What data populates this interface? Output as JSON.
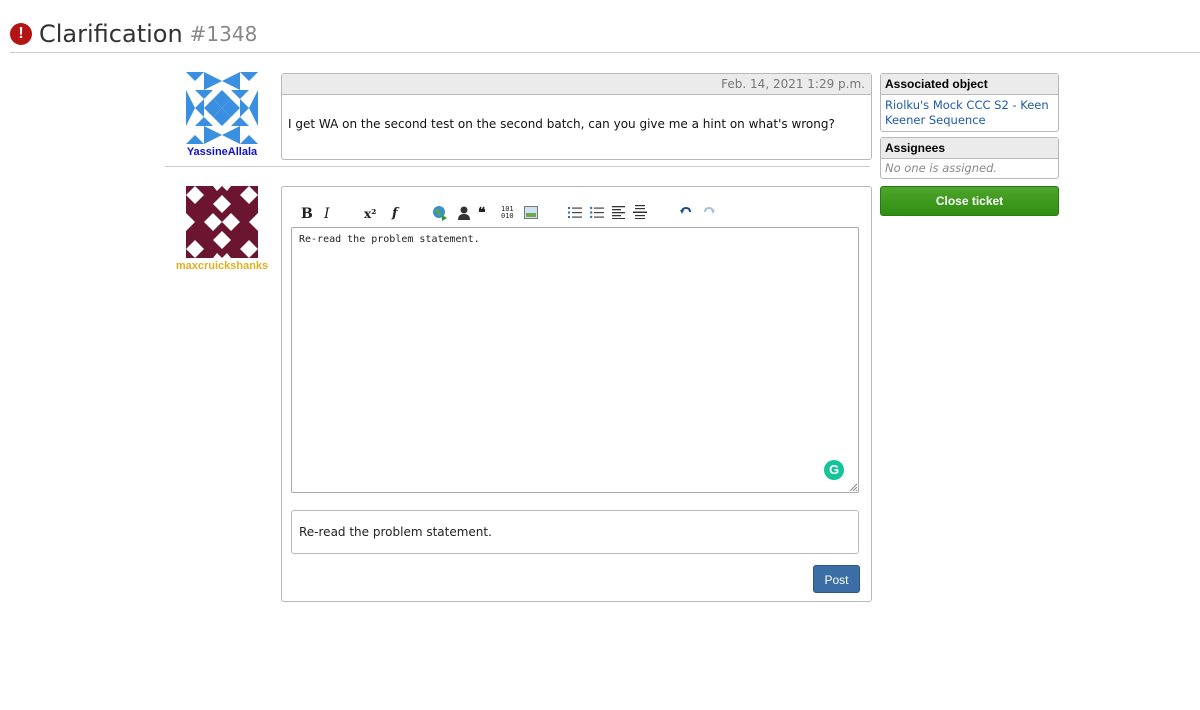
{
  "page": {
    "title": "Clarification",
    "ticket_number": "#1348"
  },
  "message": {
    "author": "YassineAllala",
    "author_color": "#1111cc",
    "timestamp": "Feb. 14, 2021 1:29 p.m.",
    "body": "I get WA on the second test on the second batch, can you give me a hint on what's wrong?"
  },
  "reply": {
    "author": "maxcruickshanks",
    "author_color": "#e0b020",
    "toolbar": {
      "bold": "B",
      "italic": "I",
      "superscript": "x²",
      "function": "f",
      "quote": "66",
      "code": "101\n010"
    },
    "textarea_value": "Re-read the problem statement.",
    "preview_text": "Re-read the problem statement.",
    "post_label": "Post"
  },
  "sidebar": {
    "associated_object": {
      "heading": "Associated object",
      "link_text": "Riolku's Mock CCC S2 - Keen Keener Sequence"
    },
    "assignees": {
      "heading": "Assignees",
      "empty_text": "No one is assigned."
    },
    "close_label": "Close ticket"
  },
  "colors": {
    "alert": "#b51414",
    "post_button": "#3a6ea5",
    "close_button": "#3a9a1a",
    "link": "#1e5aa6"
  }
}
